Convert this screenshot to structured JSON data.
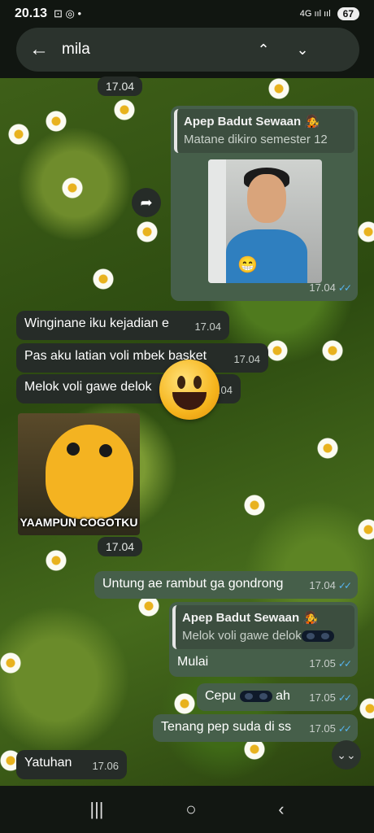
{
  "status_bar": {
    "time": "20.13",
    "icons_left": "⊡ ◎ •",
    "network": "4G ııl ııl",
    "battery": "67"
  },
  "search": {
    "query": "mila",
    "back_icon": "arrow-left-icon",
    "up_icon": "chevron-up-icon",
    "down_icon": "chevron-down-icon"
  },
  "messages": {
    "date_top": "17.04",
    "out_photo": {
      "quote_name": "Apep Badut Sewaan",
      "quote_emoji": "🧑‍🎤",
      "quote_text": "Matane dikiro semester 12",
      "time": "17.04",
      "ticks": "✓✓"
    },
    "in1": {
      "text": "Winginane iku kejadian e",
      "time": "17.04"
    },
    "in2": {
      "text": "Pas aku latian voli mbek basket",
      "time": "17.04"
    },
    "in3": {
      "text": "Melok voli gawe delok",
      "time": "17.04"
    },
    "sticker": {
      "caption": "YAAMPUN COGOTKU",
      "time": "17.04"
    },
    "out1": {
      "text": "Untung ae rambut ga gondrong",
      "time": "17.04",
      "ticks": "✓✓"
    },
    "out_reply": {
      "quote_name": "Apep Badut Sewaan",
      "quote_emoji": "🧑‍🎤",
      "quote_text": "Melok voli gawe delok",
      "text": "Mulai",
      "time": "17.05",
      "ticks": "✓✓"
    },
    "out2": {
      "text_before": "Cepu",
      "text_after": "ah",
      "time": "17.05",
      "ticks": "✓✓"
    },
    "out3": {
      "text": "Tenang pep suda di ss",
      "time": "17.05",
      "ticks": "✓✓"
    },
    "in4": {
      "text": "Yatuhan",
      "time": "17.06"
    }
  },
  "nav": {
    "recent": "|||",
    "home": "○",
    "back": "‹"
  },
  "colors": {
    "incoming": "#262c28",
    "outgoing": "#465f4a",
    "read_ticks": "#56b4f0"
  }
}
